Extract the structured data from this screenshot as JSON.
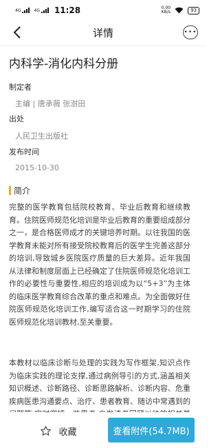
{
  "status_bar": {
    "signal_1": "4G",
    "signal_2": "4G",
    "time": "11:28",
    "net_speed_value": "0.00",
    "net_speed_unit": "KB/s",
    "battery": "93"
  },
  "nav": {
    "title": "详情",
    "more_label": "•••"
  },
  "document": {
    "title": "内科学-消化内科分册",
    "author_label": "制定者",
    "author_value": "主编 | 唐承薇 张澍田",
    "publisher_label": "出处",
    "publisher_value": "人民卫生出版社",
    "date_label": "发布时间",
    "date_value": "2015-10-30"
  },
  "intro": {
    "heading": "简介",
    "paragraphs": [
      "完整的医学教育包括院校教育、毕业后教育和继续教育。住院医师规范化培训是毕业后教育的重要组成部分之一，是合格医师成才的关键培养时期。以往我国的医学教育未能对所有接受院校教育后的医学生完善这部分的培训,导致城乡医院医疗质量的巨大差异。近年我国从法律和制度层面上已经确定了住院医师规范化培训工作的必要性与重要性,相应的培训成为以“5+3”为主体的临床医学教育综合改革的重点和难点。为全面做好住院医师规范化培训工作,编写适合这一时期学习的住院医师规范化培训教材,至关重要。",
      "本教材以临床诊断与处理的实践为写作框架,知识点作为临床实践的理论支撑,通过病例导引的方式,涵盖相关知识概述、诊断路径、诊断思路解析、诊断内容、危重疾病医患沟通要点、治疗、患者教育、随访中常遇到的问题等,实时穿插一些思考,启发读者回顾以往的相关基本知识或拓展阅读,鼓励"
    ]
  },
  "bottom_bar": {
    "favorite_label": "收藏",
    "attachment_label": "查看附件(54.7MB)"
  },
  "colors": {
    "accent": "#2fa9d9",
    "section_marker": "#f3a826"
  }
}
